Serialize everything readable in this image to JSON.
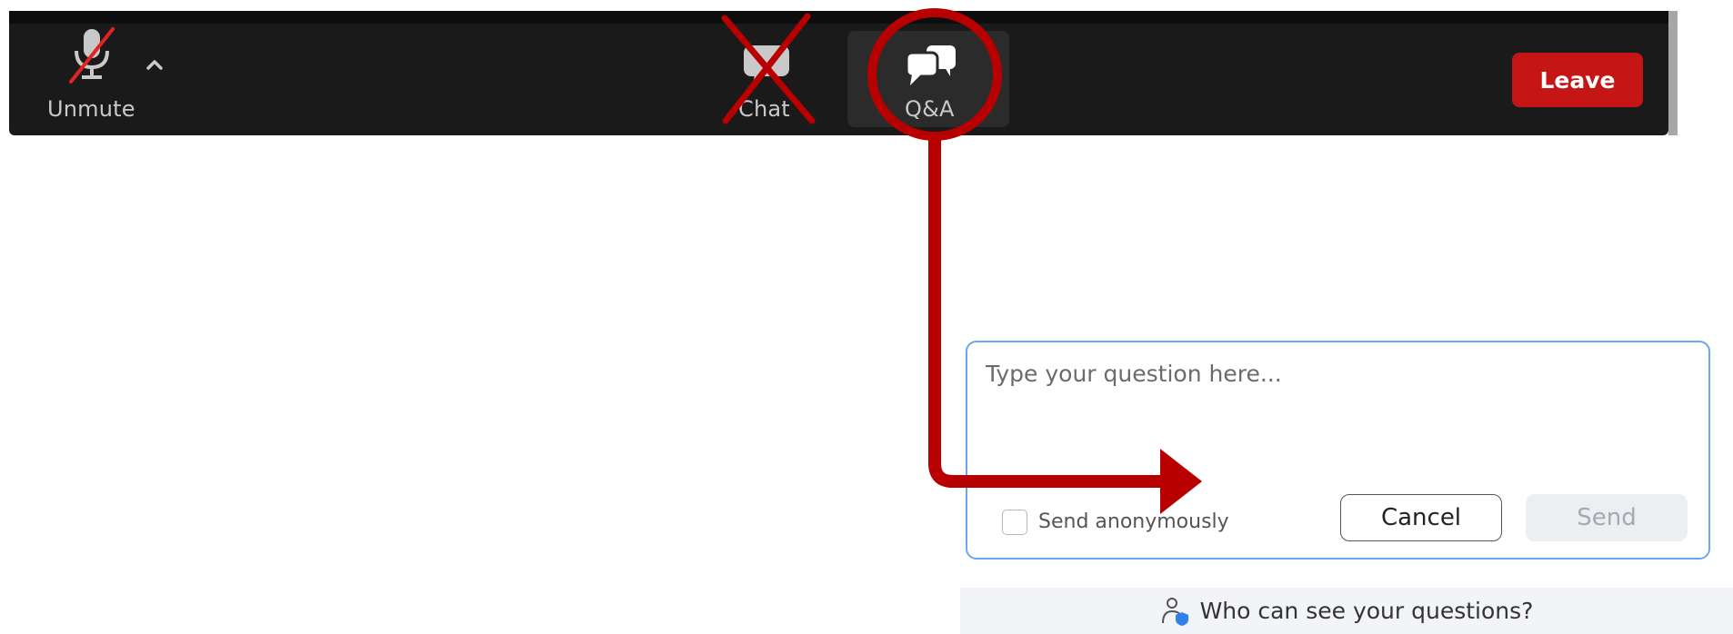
{
  "toolbar": {
    "unmute_label": "Unmute",
    "chat_label": "Chat",
    "qa_label": "Q&A",
    "leave_label": "Leave",
    "leave_color": "#c51515",
    "background_color": "#1a1a1a",
    "icons": {
      "mic": "microphone-muted-icon",
      "caret": "chevron-up-icon",
      "chat": "chat-bubble-icon",
      "qa": "qa-bubbles-icon"
    }
  },
  "annotation": {
    "color": "#b80000",
    "chat_marked": "crossed-out",
    "qa_marked": "circled",
    "arrow_target": "question-input"
  },
  "qa_panel": {
    "placeholder": "Type your question here...",
    "anonymous_label": "Send anonymously",
    "anonymous_checked": false,
    "cancel_label": "Cancel",
    "send_label": "Send",
    "border_color": "#6aa8e8",
    "who_can_see_label": "Who can see your questions?",
    "who_icon": "person-shield-icon"
  }
}
